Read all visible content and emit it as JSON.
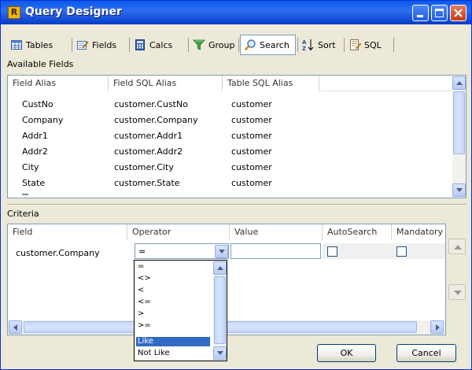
{
  "window": {
    "title": "Query Designer",
    "app_icon_letter": "R"
  },
  "toolbar": {
    "tabs": [
      {
        "label": "Tables",
        "icon": "table-icon"
      },
      {
        "label": "Fields",
        "icon": "fields-icon"
      },
      {
        "label": "Calcs",
        "icon": "calculator-icon"
      },
      {
        "label": "Group",
        "icon": "funnel-icon"
      },
      {
        "label": "Search",
        "icon": "search-icon",
        "active": true
      },
      {
        "label": "Sort",
        "icon": "sort-az-icon"
      },
      {
        "label": "SQL",
        "icon": "sql-icon"
      }
    ]
  },
  "available_fields": {
    "label": "Available Fields",
    "columns": [
      "Field Alias",
      "Field SQL Alias",
      "Table SQL Alias"
    ],
    "rows": [
      [
        "CustNo",
        "customer.CustNo",
        "customer"
      ],
      [
        "Company",
        "customer.Company",
        "customer"
      ],
      [
        "Addr1",
        "customer.Addr1",
        "customer"
      ],
      [
        "Addr2",
        "customer.Addr2",
        "customer"
      ],
      [
        "City",
        "customer.City",
        "customer"
      ],
      [
        "State",
        "customer.State",
        "customer"
      ]
    ]
  },
  "criteria": {
    "label": "Criteria",
    "columns": [
      "Field",
      "Operator",
      "Value",
      "AutoSearch",
      "Mandatory"
    ],
    "row": {
      "field": "customer.Company",
      "operator": "=",
      "value": "",
      "autosearch": false,
      "mandatory": false
    },
    "operator_options": [
      "=",
      "<>",
      "<",
      "<=",
      ">",
      ">=",
      "Like",
      "Not Like"
    ],
    "selected_option": "Like"
  },
  "buttons": {
    "ok": "OK",
    "cancel": "Cancel"
  },
  "colors": {
    "title_bar": "#0a58e8",
    "selection": "#316ac5",
    "window_face": "#ece9d8"
  }
}
